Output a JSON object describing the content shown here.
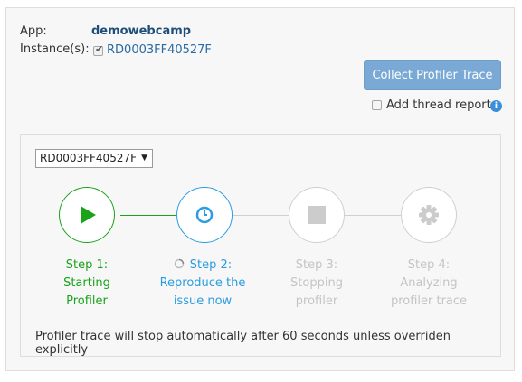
{
  "header": {
    "app_label": "App:",
    "app_name": "demowebcamp",
    "instances_label": "Instance(s):",
    "instance_id": "RD0003FF40527F"
  },
  "actions": {
    "collect_button": "Collect Profiler Trace",
    "thread_report_label": "Add thread report",
    "info_icon_glyph": "i"
  },
  "profiler": {
    "instance_select": "RD0003FF40527F",
    "steps": [
      {
        "line1": "Step 1:",
        "line2": "Starting",
        "line3": "Profiler",
        "status": "complete",
        "icon": "play-icon"
      },
      {
        "line1": "Step 2:",
        "line2": "Reproduce the",
        "line3": "issue now",
        "status": "active",
        "icon": "clock-icon"
      },
      {
        "line1": "Step 3:",
        "line2": "Stopping",
        "line3": "profiler",
        "status": "pending",
        "icon": "stop-icon"
      },
      {
        "line1": "Step 4:",
        "line2": "Analyzing",
        "line3": "profiler trace",
        "status": "pending",
        "icon": "gear-icon"
      }
    ],
    "note": "Profiler trace will stop automatically after 60 seconds unless overriden explicitly"
  },
  "colors": {
    "complete": "#1aa31a",
    "active": "#2a9ce0",
    "pending": "#cccccc",
    "button": "#79a9d4"
  }
}
